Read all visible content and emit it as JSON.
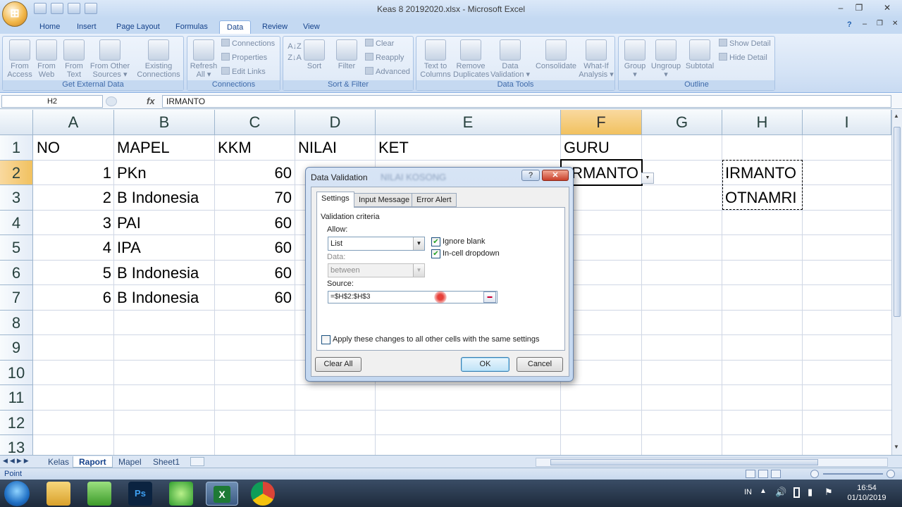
{
  "window": {
    "title": "Keas 8 20192020.xlsx - Microsoft Excel",
    "office_button": "⊞"
  },
  "win_controls": {
    "minimize": "–",
    "maximize": "❐",
    "close": "✕"
  },
  "ribbon_controls": {
    "help": "?",
    "minimize": "–",
    "restore": "❐",
    "close": "✕"
  },
  "tabs": [
    "Home",
    "Insert",
    "Page Layout",
    "Formulas",
    "Data",
    "Review",
    "View"
  ],
  "active_tab": "Data",
  "ribbon": {
    "get_external_data": {
      "label": "Get External Data",
      "buttons": [
        [
          "From",
          "Access"
        ],
        [
          "From",
          "Web"
        ],
        [
          "From",
          "Text"
        ],
        [
          "From Other",
          "Sources ▾"
        ],
        [
          "Existing",
          "Connections"
        ]
      ]
    },
    "connections": {
      "label": "Connections",
      "refresh": [
        "Refresh",
        "All ▾"
      ],
      "items": [
        "Connections",
        "Properties",
        "Edit Links"
      ]
    },
    "sort_filter": {
      "label": "Sort & Filter",
      "sort": "Sort",
      "filter": "Filter",
      "items": [
        "Clear",
        "Reapply",
        "Advanced"
      ]
    },
    "data_tools": {
      "label": "Data Tools",
      "buttons": [
        [
          "Text to",
          "Columns"
        ],
        [
          "Remove",
          "Duplicates"
        ],
        [
          "Data",
          "Validation ▾"
        ],
        [
          "Consolidate",
          ""
        ],
        [
          "What-If",
          "Analysis ▾"
        ]
      ]
    },
    "outline": {
      "label": "Outline",
      "buttons": [
        [
          "Group",
          "▾"
        ],
        [
          "Ungroup",
          "▾"
        ],
        [
          "Subtotal",
          ""
        ]
      ],
      "items": [
        "Show Detail",
        "Hide Detail"
      ]
    }
  },
  "formula_bar": {
    "name_box": "H2",
    "fx": "fx",
    "value": "IRMANTO"
  },
  "columns": [
    "A",
    "B",
    "C",
    "D",
    "E",
    "F",
    "G",
    "H",
    "I"
  ],
  "rows": [
    "1",
    "2",
    "3",
    "4",
    "5",
    "6",
    "7",
    "8",
    "9",
    "10",
    "11",
    "12",
    "13"
  ],
  "cells": {
    "header": {
      "A": "NO",
      "B": "MAPEL",
      "C": "KKM",
      "D": "NILAI",
      "E": "KET",
      "F": "GURU"
    },
    "data": [
      {
        "no": "1",
        "mapel": "PKn",
        "kkm": "60"
      },
      {
        "no": "2",
        "mapel": "B Indonesia",
        "kkm": "70"
      },
      {
        "no": "3",
        "mapel": "PAI",
        "kkm": "60"
      },
      {
        "no": "4",
        "mapel": "IPA",
        "kkm": "60"
      },
      {
        "no": "5",
        "mapel": "B Indonesia",
        "kkm": "60"
      },
      {
        "no": "6",
        "mapel": "B Indonesia",
        "kkm": "60"
      }
    ],
    "f2": "RMANTO",
    "h2": "IRMANTO",
    "h3": "OTNAMRI"
  },
  "sheet_tabs": [
    "Kelas",
    "Raport",
    "Mapel",
    "Sheet1"
  ],
  "active_sheet": "Raport",
  "status": "Point",
  "dialog": {
    "title": "Data Validation",
    "blurred_text": "NILAI KOSONG",
    "help": "?",
    "close": "✕",
    "tabs": [
      "Settings",
      "Input Message",
      "Error Alert"
    ],
    "section": "Validation criteria",
    "allow_label": "Allow:",
    "allow_value": "List",
    "ignore_blank": "Ignore blank",
    "in_cell_dropdown": "In-cell dropdown",
    "data_label": "Data:",
    "data_value": "between",
    "source_label": "Source:",
    "source_value": "=$H$2:$H$3",
    "apply_all": "Apply these changes to all other cells with the same settings",
    "clear_all": "Clear All",
    "ok": "OK",
    "cancel": "Cancel"
  },
  "taskbar": {
    "apps": [
      "start-orb",
      "explorer",
      "notepad",
      "Ps",
      "app-green",
      "excel",
      "chrome"
    ],
    "lang": "IN",
    "time": "16:54",
    "date": "01/10/2019"
  }
}
